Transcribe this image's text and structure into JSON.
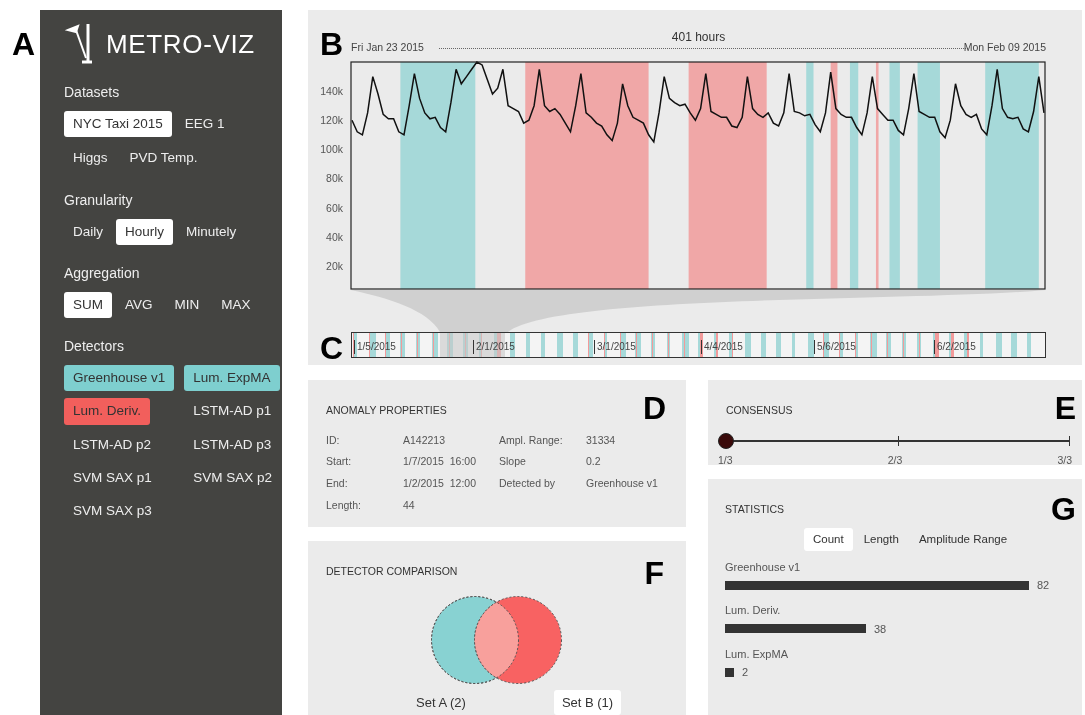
{
  "sidebar": {
    "letter": "A",
    "logo": "METRO-VIZ",
    "sections": [
      {
        "title": "Datasets",
        "options": [
          {
            "label": "NYC Taxi 2015",
            "selected": true
          },
          {
            "label": "EEG 1",
            "selected": false
          },
          {
            "label": "Higgs",
            "selected": false
          },
          {
            "label": "PVD Temp.",
            "selected": false
          }
        ]
      },
      {
        "title": "Granularity",
        "options": [
          {
            "label": "Daily",
            "selected": false
          },
          {
            "label": "Hourly",
            "selected": true
          },
          {
            "label": "Minutely",
            "selected": false
          }
        ]
      },
      {
        "title": "Aggregation",
        "options": [
          {
            "label": "SUM",
            "selected": true
          },
          {
            "label": "AVG",
            "selected": false
          },
          {
            "label": "MIN",
            "selected": false
          },
          {
            "label": "MAX",
            "selected": false
          }
        ]
      }
    ],
    "detectors": {
      "title": "Detectors",
      "options": [
        {
          "label": "Greenhouse v1",
          "selected": true,
          "color": "#7ecfcf"
        },
        {
          "label": "Lum. ExpMA",
          "selected": true,
          "color": "#7ecfcf"
        },
        {
          "label": "Lum. Deriv.",
          "selected": true,
          "color": "#f25f5c"
        },
        {
          "label": "LSTM-AD p1",
          "selected": false
        },
        {
          "label": "LSTM-AD p2",
          "selected": false
        },
        {
          "label": "LSTM-AD p3",
          "selected": false
        },
        {
          "label": "SVM SAX p1",
          "selected": false
        },
        {
          "label": "SVM SAX p2",
          "selected": false
        },
        {
          "label": "SVM SAX p3",
          "selected": false
        }
      ]
    }
  },
  "timeseries": {
    "letter": "B",
    "start": "Fri Jan 23 2015",
    "span": "401 hours",
    "end": "Mon Feb 09 2015",
    "chart_data": {
      "type": "line",
      "ylim": [
        4000,
        160000
      ],
      "yticks": [
        {
          "value": 20000,
          "label": "20k"
        },
        {
          "value": 40000,
          "label": "40k"
        },
        {
          "value": 60000,
          "label": "60k"
        },
        {
          "value": 80000,
          "label": "80k"
        },
        {
          "value": 100000,
          "label": "100k"
        },
        {
          "value": 120000,
          "label": "120k"
        },
        {
          "value": 140000,
          "label": "140k"
        }
      ],
      "categories": [
        null,
        null,
        null,
        null,
        null,
        null,
        null,
        null,
        null,
        null,
        null,
        null,
        null,
        null,
        null,
        null,
        null,
        null,
        null,
        null,
        null,
        null,
        null,
        null,
        null,
        null,
        null,
        null,
        null,
        null,
        null,
        null,
        null,
        null,
        null,
        null,
        null,
        null,
        null,
        null,
        null,
        null,
        null,
        null,
        null,
        null,
        null,
        null,
        null,
        null,
        null,
        null,
        null,
        null,
        null,
        null,
        null,
        null,
        null,
        null,
        null,
        null,
        null,
        null,
        null,
        null,
        null,
        null,
        null,
        null,
        null,
        null,
        null,
        null,
        null,
        null,
        null,
        null,
        null,
        null,
        null,
        null,
        null,
        null,
        null,
        null,
        null,
        null,
        null,
        null,
        null,
        null,
        null,
        null,
        null,
        null,
        null,
        null,
        null,
        null,
        null,
        null,
        null,
        null,
        null,
        null,
        null,
        null,
        null,
        null,
        null,
        null,
        null,
        null,
        null,
        null,
        null,
        null,
        null,
        null,
        null,
        null,
        null,
        null,
        null,
        null,
        null,
        null,
        null,
        null,
        null,
        null,
        null,
        null
      ],
      "series": [
        {
          "color": "#111111",
          "values": [
            120000,
            112000,
            110000,
            125000,
            150000,
            138000,
            124000,
            121000,
            121000,
            112000,
            110000,
            130000,
            152000,
            135000,
            125000,
            121000,
            122000,
            115000,
            112000,
            132000,
            155000,
            145000,
            150000,
            155000,
            160000,
            158000,
            148000,
            138000,
            142000,
            155000,
            130000,
            128000,
            126000,
            118000,
            120000,
            130000,
            155000,
            130000,
            126000,
            128000,
            124000,
            118000,
            112000,
            130000,
            152000,
            125000,
            122000,
            118000,
            116000,
            110000,
            106000,
            118000,
            145000,
            130000,
            122000,
            120000,
            118000,
            110000,
            105000,
            125000,
            150000,
            135000,
            132000,
            130000,
            131000,
            125000,
            120000,
            128000,
            152000,
            126000,
            124000,
            122000,
            122000,
            116000,
            115000,
            122000,
            150000,
            128000,
            124000,
            122000,
            125000,
            118000,
            116000,
            125000,
            152000,
            126000,
            125000,
            123000,
            124000,
            117000,
            112000,
            125000,
            153000,
            128000,
            124000,
            122000,
            122000,
            115000,
            110000,
            125000,
            150000,
            128000,
            124000,
            120000,
            120000,
            113000,
            110000,
            128000,
            152000,
            126000,
            124000,
            122000,
            122000,
            112000,
            108000,
            120000,
            145000,
            130000,
            124000,
            122000,
            124000,
            114000,
            110000,
            130000,
            155000,
            128000,
            122000,
            121000,
            122000,
            114000,
            112000,
            126000,
            150000,
            125000
          ]
        }
      ]
    },
    "anomalies": [
      {
        "color": "#a6d9d9"
      },
      {
        "color": "#f0a7a7"
      },
      {
        "color": "#f0a7a7"
      },
      {
        "color": "#a6d9d9"
      },
      {
        "color": "#f0a7a7"
      },
      {
        "color": "#a6d9d9"
      },
      {
        "color": "#f0a7a7"
      },
      {
        "color": "#a6d9d9"
      },
      {
        "color": "#a6d9d9"
      },
      {
        "color": "#a6d9d9"
      }
    ]
  },
  "overview": {
    "letter": "C",
    "dates": [
      "1/5/2015",
      "2/1/2015",
      "3/1/2015",
      "4/4/2015",
      "5/6/2015",
      "6/2/2015"
    ]
  },
  "anomaly_properties": {
    "letter": "D",
    "title": "ANOMALY PROPERTIES",
    "rows": [
      {
        "label": "ID:",
        "value": "A142213",
        "label_2": "Ampl. Range:",
        "value_2": "31334"
      },
      {
        "label": "Start:",
        "value": "1/7/2015  16:00",
        "label_2": "Slope",
        "value_2": "0.2"
      },
      {
        "label": "End:",
        "value": "1/2/2015  12:00",
        "label_2": "Detected by",
        "value_2": "Greenhouse v1"
      },
      {
        "label": "Length:",
        "value": "44"
      }
    ]
  },
  "detector_comparison": {
    "letter": "F",
    "title": "DETECTOR COMPARISON",
    "sets": [
      {
        "label": "Set A (2)",
        "color": "#88d2d2",
        "selected": false
      },
      {
        "label": "Set B (1)",
        "color": "#f86262",
        "selected": true
      }
    ]
  },
  "consensus": {
    "letter": "E",
    "title": "CONSENSUS",
    "level": 0,
    "ticks": [
      "1/3",
      "2/3",
      "3/3"
    ]
  },
  "statistics": {
    "letter": "G",
    "title": "STATISTICS",
    "tabs": [
      {
        "label": "Count",
        "selected": true
      },
      {
        "label": "Length",
        "selected": false
      },
      {
        "label": "Amplitude Range",
        "selected": false
      }
    ],
    "bars": [
      {
        "name": "Greenhouse v1",
        "value": "82"
      },
      {
        "name": "Lum. Deriv.",
        "value": "38"
      },
      {
        "name": "Lum. ExpMA",
        "value": "2"
      }
    ]
  }
}
